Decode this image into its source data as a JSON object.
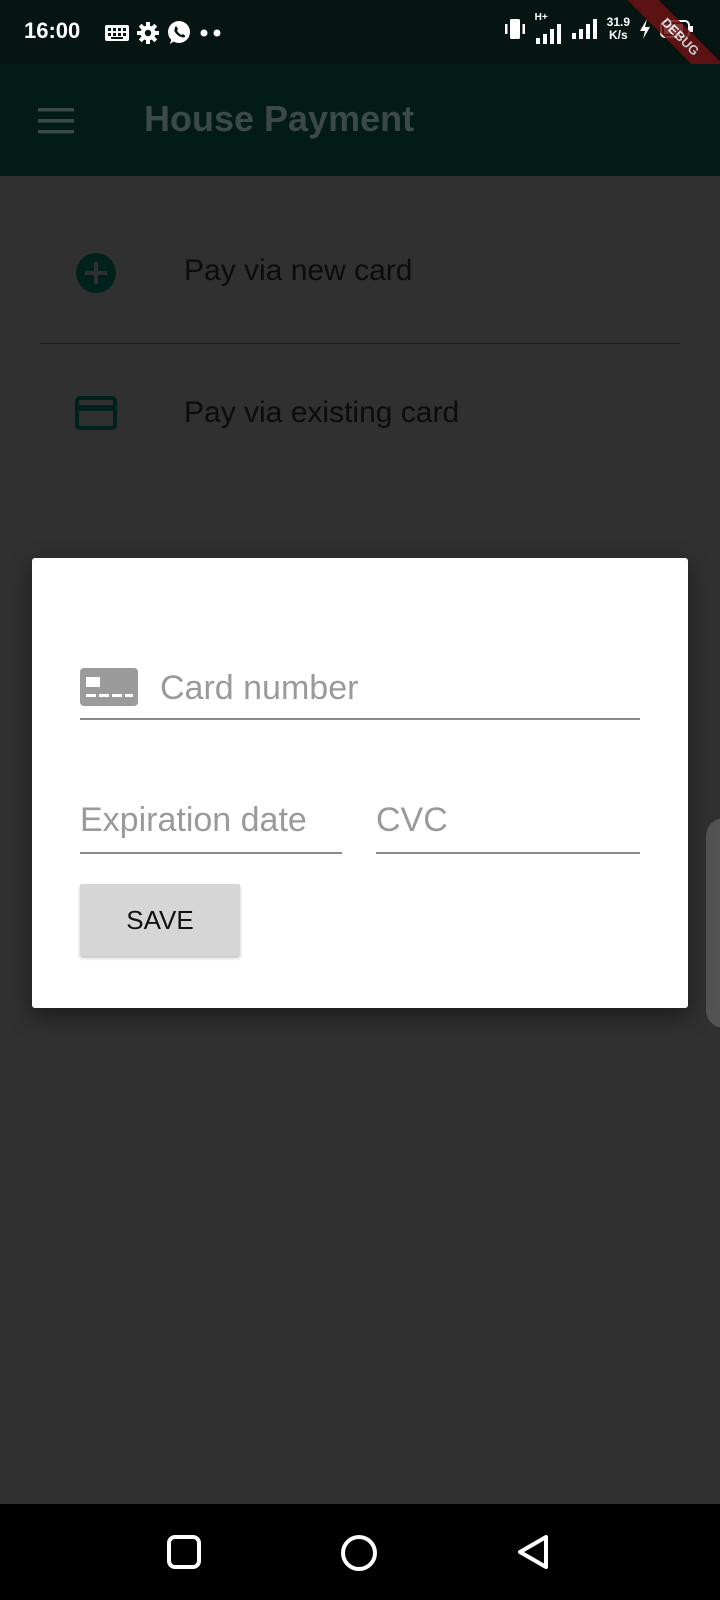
{
  "status_bar": {
    "time": "16:00",
    "speed_value": "31.9",
    "speed_unit": "K/s",
    "network_type": "H+",
    "debug_banner": "DEBUG",
    "icons": [
      "keyboard-icon",
      "gear-icon",
      "whatsapp-icon",
      "more-dots-icon",
      "vibrate-icon",
      "signal-icon",
      "signal-icon",
      "charging-icon",
      "battery-icon"
    ]
  },
  "app_bar": {
    "title": "House Payment",
    "menu_icon": "menu-icon"
  },
  "list": {
    "items": [
      {
        "label": "Pay via new card",
        "icon": "add-circle-icon"
      },
      {
        "label": "Pay via existing card",
        "icon": "credit-card-icon"
      }
    ]
  },
  "dialog": {
    "card_number_placeholder": "Card number",
    "expiration_placeholder": "Expiration date",
    "cvc_placeholder": "CVC",
    "save_label": "SAVE"
  },
  "colors": {
    "accent": "#004d40",
    "app_bar_bg": "#021b17",
    "scrim_bg": "#303030"
  }
}
